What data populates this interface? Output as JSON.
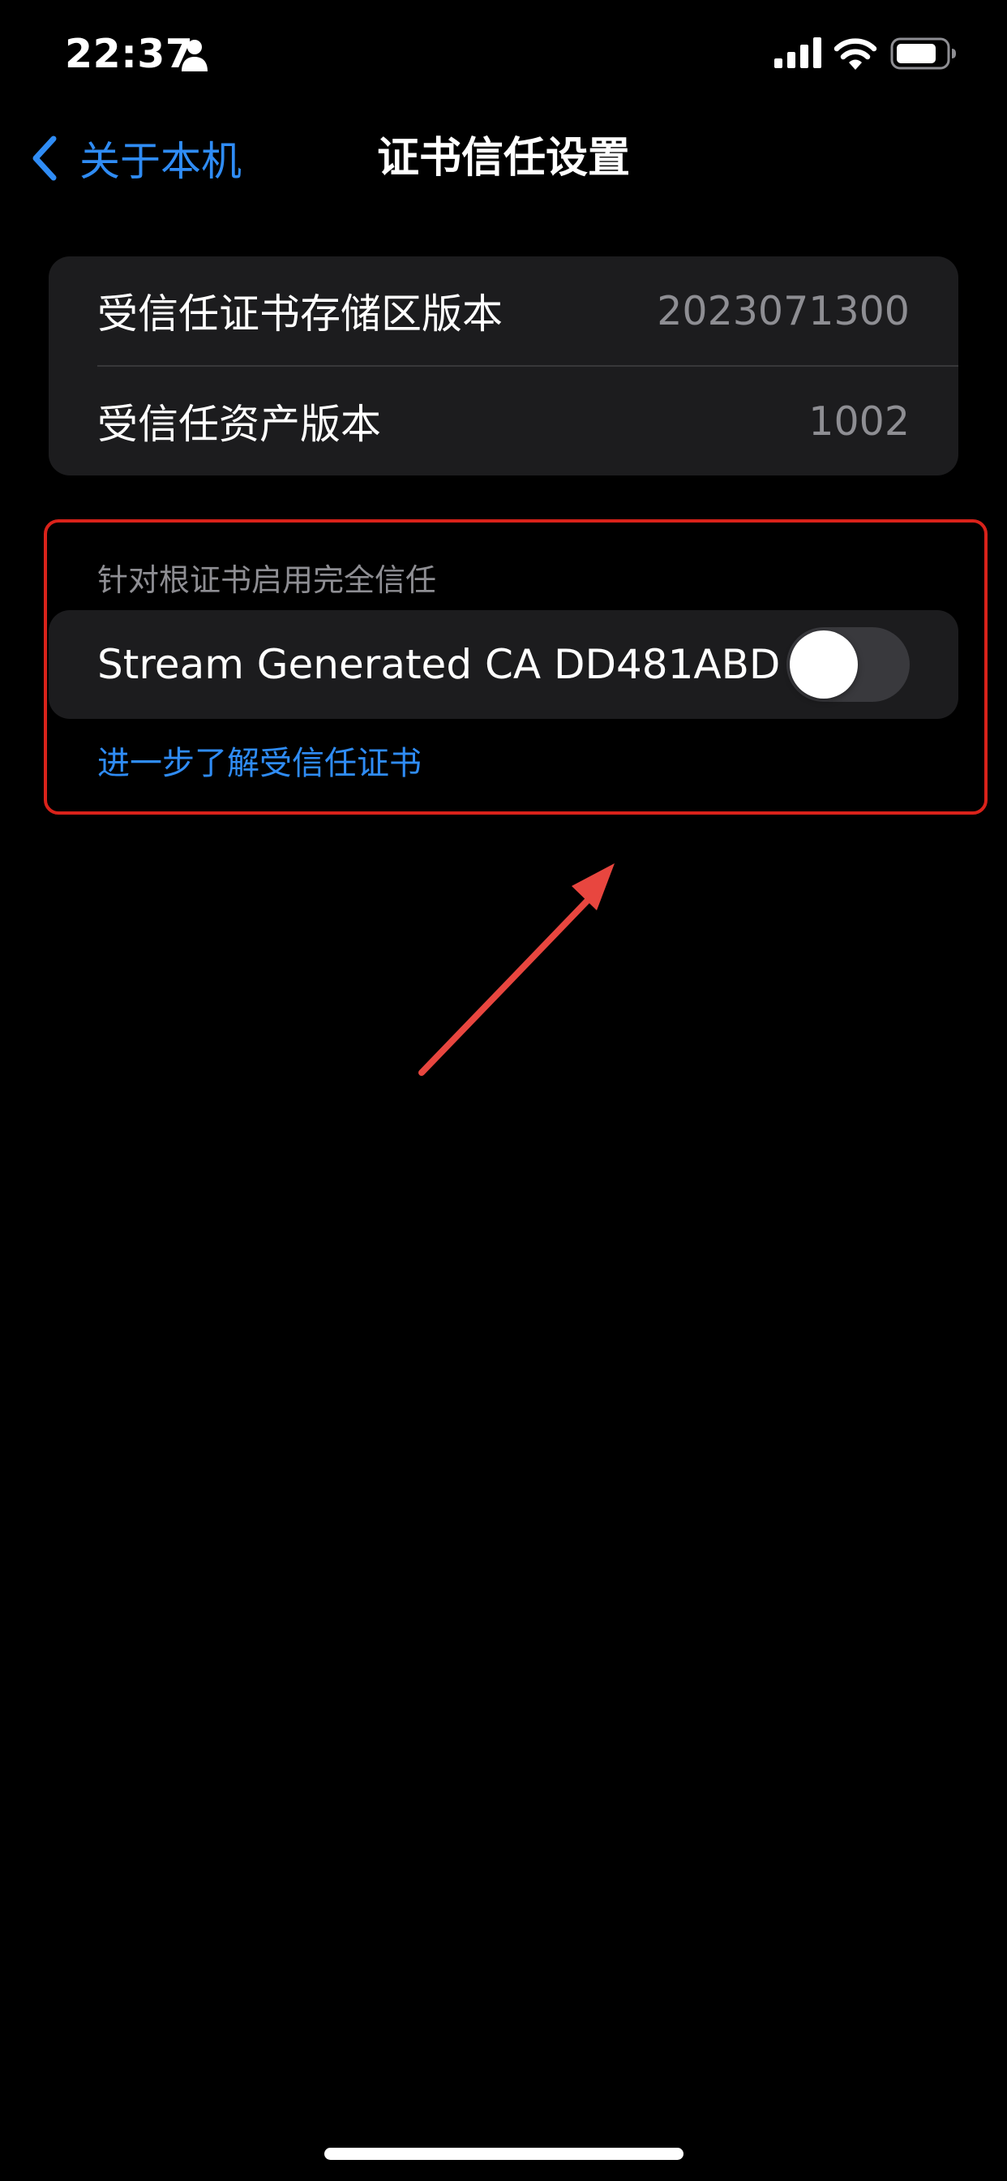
{
  "status_bar": {
    "time": "22:37",
    "icons": [
      "person-icon",
      "signal-icon",
      "wifi-icon",
      "battery-icon"
    ]
  },
  "nav": {
    "back_label": "关于本机",
    "title": "证书信任设置"
  },
  "info_group": {
    "rows": [
      {
        "label": "受信任证书存储区版本",
        "value": "2023071300"
      },
      {
        "label": "受信任资产版本",
        "value": "1002"
      }
    ]
  },
  "trust_section": {
    "header": "针对根证书启用完全信任",
    "certificate_name": "Stream Generated CA DD481ABD",
    "toggle_on": false,
    "learn_more_link": "进一步了解受信任证书"
  },
  "colors": {
    "background": "#000000",
    "cell_background": "#1c1c1e",
    "accent": "#2f8cf5",
    "secondary_text": "#8e8e93",
    "annotation_red": "#d9221a",
    "annotation_arrow": "#e8463f"
  }
}
